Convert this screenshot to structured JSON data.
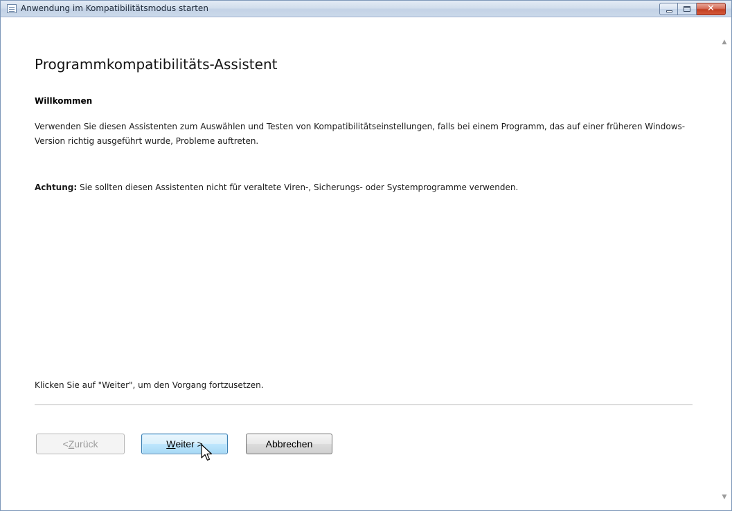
{
  "window": {
    "title": "Anwendung im Kompatibilitätsmodus starten"
  },
  "wizard": {
    "heading": "Programmkompatibilitäts-Assistent",
    "subheading": "Willkommen",
    "description": "Verwenden Sie diesen Assistenten zum Auswählen und Testen von Kompatibilitätseinstellungen, falls bei einem Programm, das auf einer früheren Windows-Version richtig ausgeführt wurde, Probleme auftreten.",
    "warning_label": "Achtung:",
    "warning_text": " Sie sollten diesen Assistenten nicht für veraltete Viren-, Sicherungs- oder Systemprogramme verwenden.",
    "footer_text": "Klicken Sie auf \"Weiter\", um den Vorgang fortzusetzen."
  },
  "buttons": {
    "back_prefix": "< ",
    "back_mnemonic": "Z",
    "back_rest": "urück",
    "back_enabled": false,
    "next_mnemonic": "W",
    "next_rest": "eiter >",
    "cancel": "Abbrechen"
  },
  "icons": {
    "window": "window-list-icon",
    "minimize": "minimize-icon",
    "maximize": "maximize-icon",
    "close": "close-icon",
    "cursor": "mouse-pointer-icon",
    "scroll_up": "scroll-up-arrow-icon",
    "scroll_down": "scroll-down-arrow-icon"
  },
  "colors": {
    "titlebar": "#d2deec",
    "close_button": "#c13f22",
    "default_button": "#bee6fd"
  }
}
